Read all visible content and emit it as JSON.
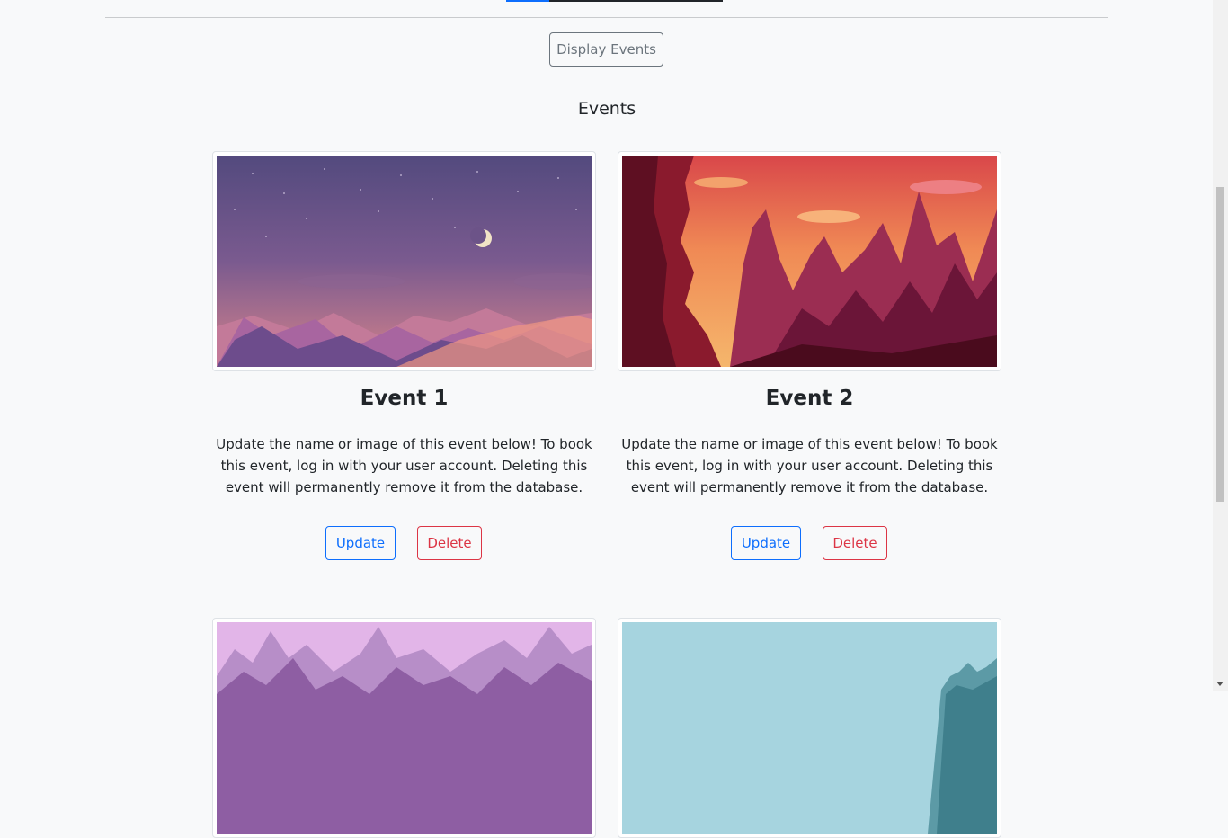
{
  "display_button_label": "Display Events",
  "section_title": "Events",
  "events": [
    {
      "title": "Event 1",
      "description": "Update the name or image of this event below! To book this event, log in with your user account. Deleting this event will permanently remove it from the database.",
      "update_label": "Update",
      "delete_label": "Delete",
      "image": "desert-dunes-night-illustration"
    },
    {
      "title": "Event 2",
      "description": "Update the name or image of this event below! To book this event, log in with your user account. Deleting this event will permanently remove it from the database.",
      "update_label": "Update",
      "delete_label": "Delete",
      "image": "red-canyon-illustration"
    },
    {
      "image": "purple-mountains-illustration"
    },
    {
      "image": "blue-mountains-illustration"
    }
  ],
  "colors": {
    "primary": "#0d6efd",
    "danger": "#dc3545",
    "secondary": "#6c757d",
    "background": "#f8f9fa"
  }
}
